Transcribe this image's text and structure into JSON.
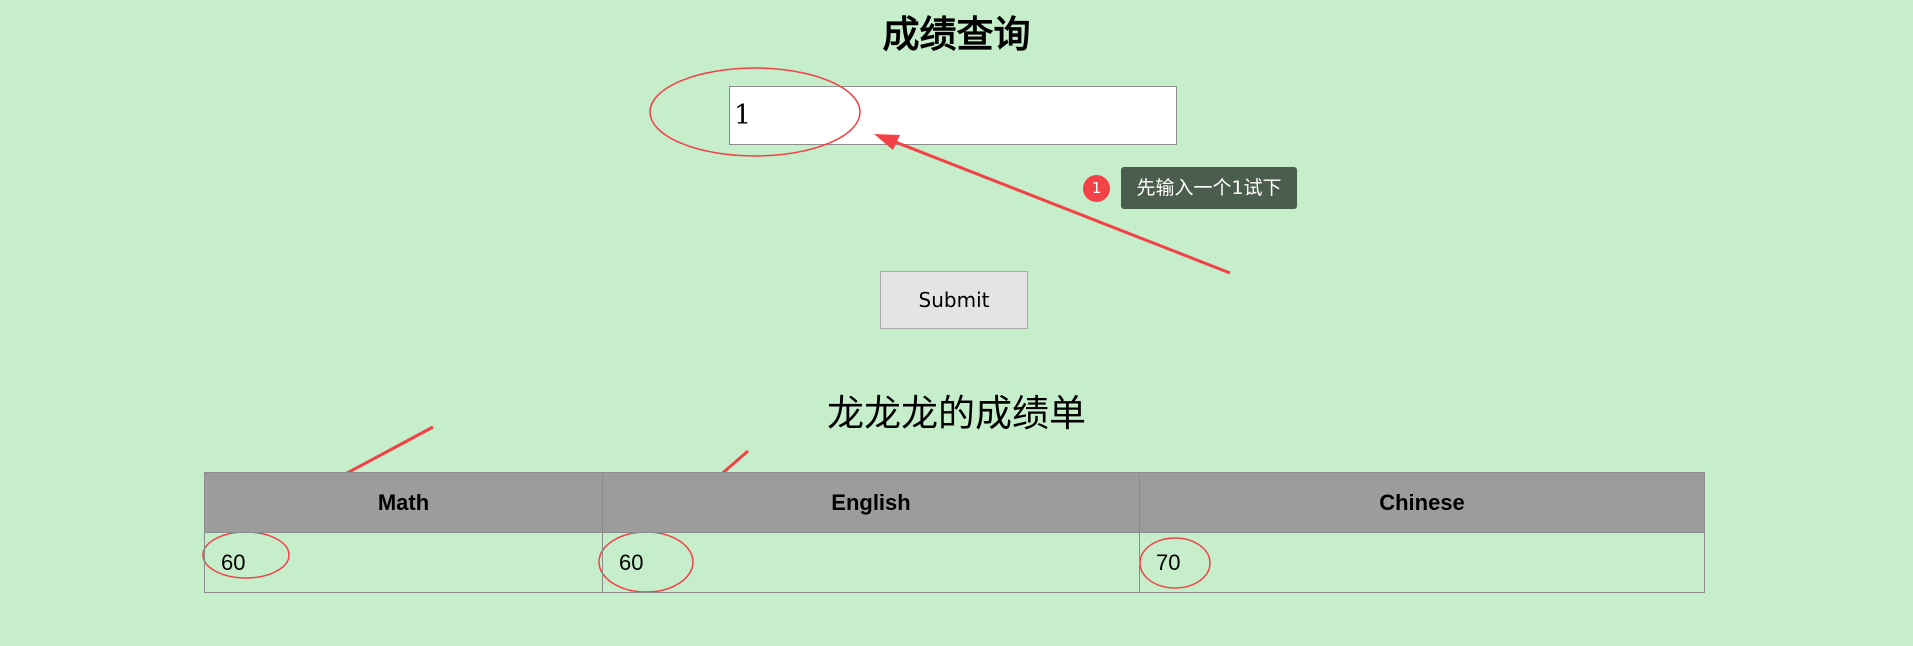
{
  "page": {
    "title": "成绩查询",
    "report_title": "龙龙龙的成绩单"
  },
  "query": {
    "value": "1",
    "submit_label": "Submit"
  },
  "hint": {
    "badge": "1",
    "text": "先输入一个1试下"
  },
  "table": {
    "headers": [
      "Math",
      "English",
      "Chinese"
    ],
    "rows": [
      [
        "60",
        "60",
        "70"
      ]
    ]
  },
  "colors": {
    "background": "#c7eecb",
    "annotation": "#f24147",
    "tooltip": "#4b5d4c",
    "header_fill": "#9c9c9c"
  }
}
